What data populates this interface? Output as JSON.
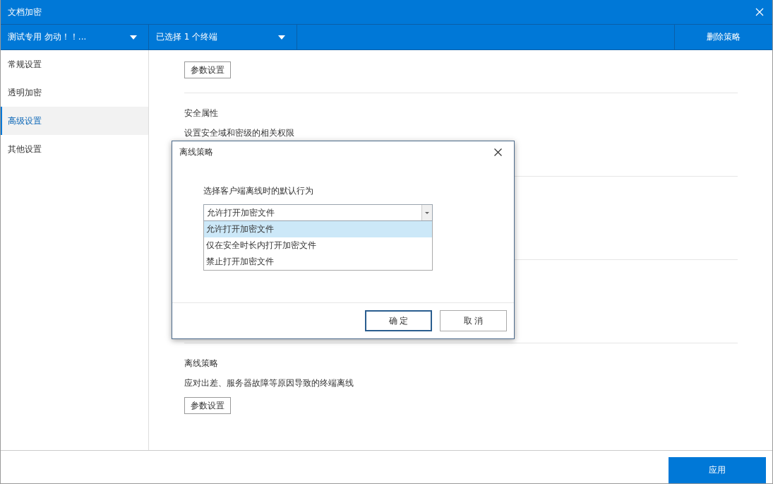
{
  "window": {
    "title": "文档加密"
  },
  "toolbar": {
    "policy_dropdown": "测试专用 勿动！！...",
    "terminal_dropdown": "已选择 1 个终端",
    "delete_button": "删除策略"
  },
  "sidebar": {
    "items": [
      {
        "label": "常规设置",
        "selected": false
      },
      {
        "label": "透明加密",
        "selected": false
      },
      {
        "label": "高级设置",
        "selected": true
      },
      {
        "label": "其他设置",
        "selected": false
      }
    ]
  },
  "sections": [
    {
      "button": "参数设置"
    },
    {
      "title": "安全属性",
      "description": "设置安全域和密级的相关权限"
    },
    {
      "title": "离线策略",
      "description": "应对出差、服务器故障等原因导致的终端离线",
      "button": "参数设置"
    }
  ],
  "dialog": {
    "title": "离线策略",
    "label": "选择客户端离线时的默认行为",
    "select": {
      "value": "允许打开加密文件",
      "expanded": true,
      "options": [
        {
          "label": "允许打开加密文件",
          "selected": true
        },
        {
          "label": "仅在安全时长内打开加密文件",
          "selected": false
        },
        {
          "label": "禁止打开加密文件",
          "selected": false
        }
      ]
    },
    "ok_button": "确 定",
    "cancel_button": "取 消"
  },
  "footer": {
    "apply_button": "应用"
  }
}
